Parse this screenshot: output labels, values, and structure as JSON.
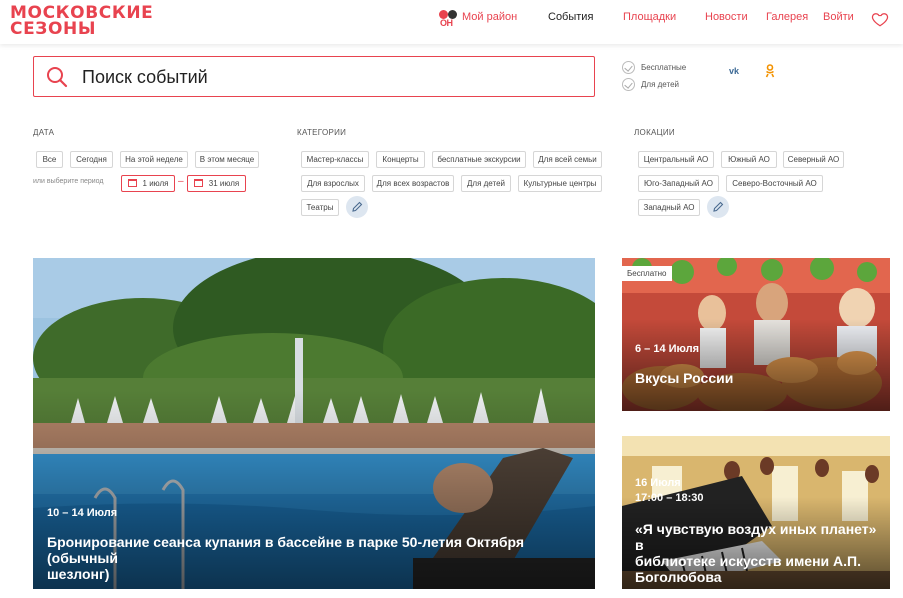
{
  "header": {
    "logo_line1": "МОСКОВСКИЕ",
    "logo_line2": "СЕЗОНЫ",
    "badge_text": "ОН",
    "nav": {
      "my_district": "Мой район",
      "events": "События",
      "venues": "Площадки",
      "news": "Новости",
      "gallery": "Галерея",
      "login": "Войти"
    }
  },
  "search": {
    "placeholder": "Поиск событий"
  },
  "quick_filters": {
    "free": "Бесплатные",
    "kids": "Для детей"
  },
  "social": {
    "vk": "vk",
    "ok": "ok"
  },
  "filters": {
    "date": {
      "title": "ДАТА",
      "options": [
        "Все",
        "Сегодня",
        "На этой неделе",
        "В этом месяце"
      ],
      "period_note": "или выберите период",
      "from": "1 июля",
      "to": "31 июля",
      "separator": "–"
    },
    "categories": {
      "title": "КАТЕГОРИИ",
      "options": [
        "Мастер-классы",
        "Концерты",
        "бесплатные экскурсии",
        "Для всей семьи",
        "Для взрослых",
        "Для всех возрастов",
        "Для детей",
        "Культурные центры",
        "Театры"
      ]
    },
    "locations": {
      "title": "ЛОКАЦИИ",
      "options": [
        "Центральный АО",
        "Южный АО",
        "Северный АО",
        "Юго-Западный АО",
        "Северо-Восточный АО",
        "Западный АО"
      ]
    }
  },
  "cards": [
    {
      "date": "10 – 14 Июля",
      "title_line1": "Бронирование сеанса купания в бассейне в парке 50-летия Октября (обычный",
      "title_line2": "шезлонг)"
    },
    {
      "badge": "Бесплатно",
      "date": "6 – 14 Июля",
      "title_line1": "Вкусы России"
    },
    {
      "date": "16 Июля",
      "time": "17:00 – 18:30",
      "title_line1": "«Я чувствую воздух иных планет» в",
      "title_line2": "библиотеке искусств имени А.П.",
      "title_line3": "Боголюбова"
    }
  ],
  "colors": {
    "accent": "#e8434f",
    "chip_border": "#d6d6d6"
  }
}
